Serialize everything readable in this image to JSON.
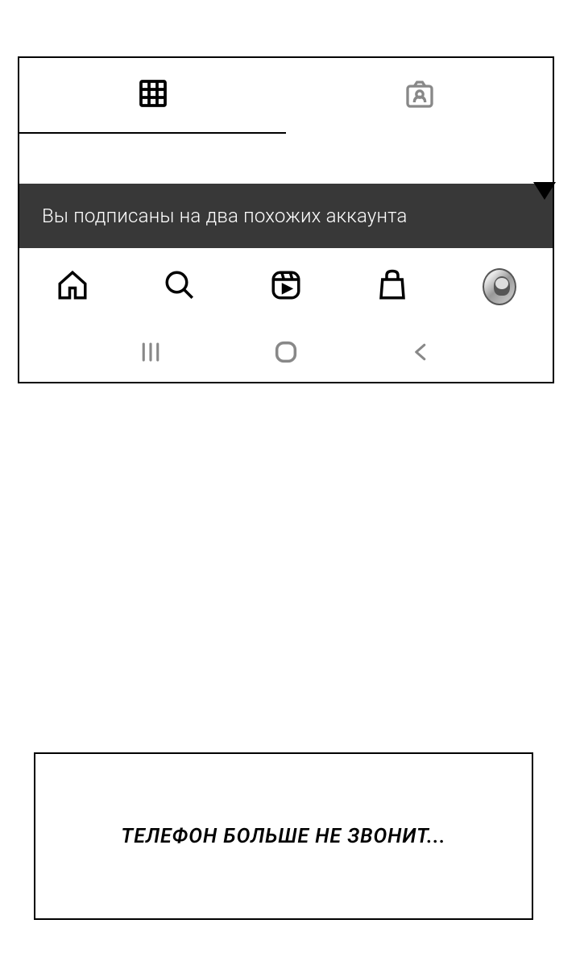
{
  "toast": {
    "message": "Вы подписаны на два похожих аккаунта"
  },
  "caption": {
    "text": "ТЕЛЕФОН БОЛЬШЕ НЕ ЗВОНИТ..."
  },
  "icons": {
    "grid": "grid-icon",
    "tagged": "tagged-icon",
    "home": "home-icon",
    "search": "search-icon",
    "reels": "reels-icon",
    "shop": "shop-icon",
    "profile": "profile-avatar"
  }
}
